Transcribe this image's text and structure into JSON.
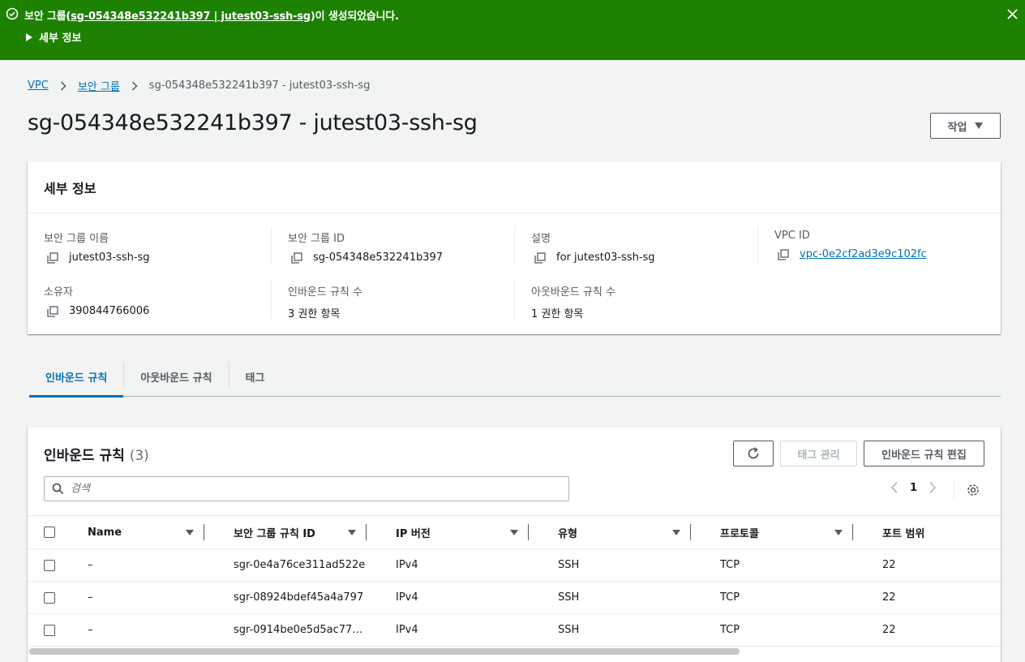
{
  "flash": {
    "message_prefix": "보안 그룹(",
    "message_link": "sg-054348e532241b397 | jutest03-ssh-sg",
    "message_suffix": ")이 생성되었습니다.",
    "details_label": "세부 정보",
    "color": "#1d8102"
  },
  "breadcrumb": {
    "items": [
      "VPC",
      "보안 그룹"
    ],
    "current": "sg-054348e532241b397 - jutest03-ssh-sg"
  },
  "page": {
    "title": "sg-054348e532241b397 - jutest03-ssh-sg",
    "actions_label": "작업"
  },
  "details": {
    "heading": "세부 정보",
    "fields": {
      "sg_name": {
        "label": "보안 그룹 이름",
        "value": "jutest03-ssh-sg"
      },
      "sg_id": {
        "label": "보안 그룹 ID",
        "value": "sg-054348e532241b397"
      },
      "description": {
        "label": "설명",
        "value": "for jutest03-ssh-sg"
      },
      "vpc_id": {
        "label": "VPC ID",
        "value": "vpc-0e2cf2ad3e9c102fc"
      },
      "owner": {
        "label": "소유자",
        "value": "390844766006"
      },
      "inbound_count": {
        "label": "인바운드 규칙 수",
        "value": "3 권한 항목"
      },
      "outbound_count": {
        "label": "아웃바운드 규칙 수",
        "value": "1 권한 항목"
      }
    }
  },
  "tabs": [
    "인바운드 규칙",
    "아웃바운드 규칙",
    "태그"
  ],
  "rules": {
    "title": "인바운드 규칙",
    "count": "(3)",
    "manage_tags_label": "태그 관리",
    "edit_label": "인바운드 규칙 편집",
    "search_placeholder": "검색",
    "page_number": "1",
    "columns": [
      "Name",
      "보안 그룹 규칙 ID",
      "IP 버전",
      "유형",
      "프로토콜",
      "포트 범위"
    ],
    "rows": [
      {
        "name": "–",
        "id": "sgr-0e4a76ce311ad522e",
        "ip": "IPv4",
        "type": "SSH",
        "protocol": "TCP",
        "port": "22"
      },
      {
        "name": "–",
        "id": "sgr-08924bdef45a4a797",
        "ip": "IPv4",
        "type": "SSH",
        "protocol": "TCP",
        "port": "22"
      },
      {
        "name": "–",
        "id": "sgr-0914be0e5d5ac77…",
        "ip": "IPv4",
        "type": "SSH",
        "protocol": "TCP",
        "port": "22"
      }
    ]
  },
  "colors": {
    "link": "#0073bb",
    "accent": "#0073bb",
    "success": "#1d8102"
  }
}
